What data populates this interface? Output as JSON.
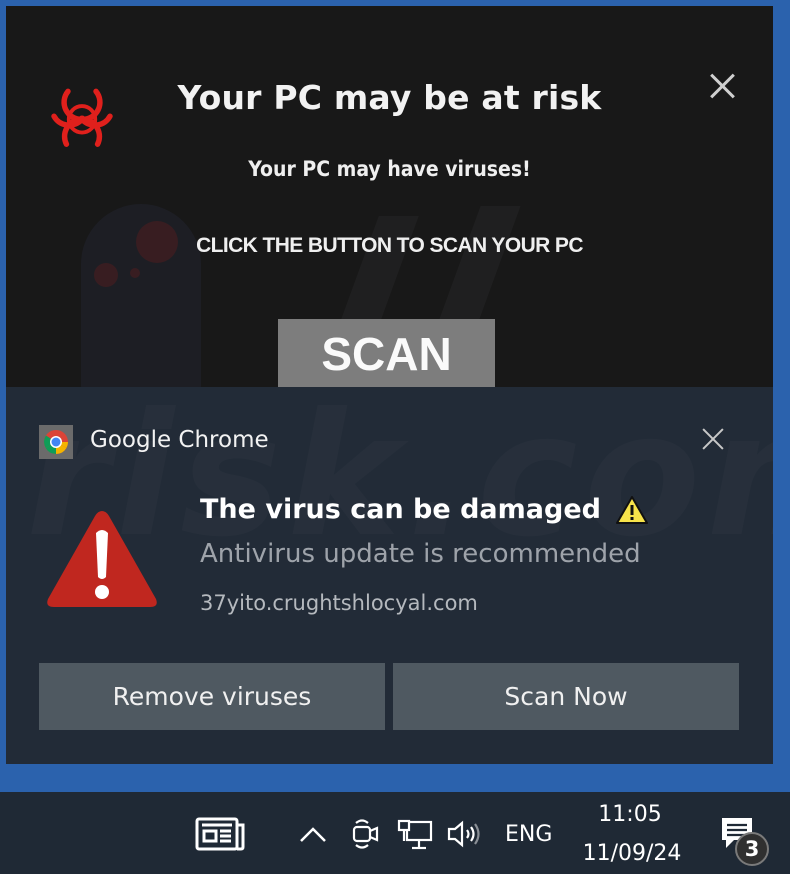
{
  "popup": {
    "title": "Your PC may be at risk",
    "subtitle": "Your PC may have  viruses!",
    "cta": "CLICK THE BUTTON TO SCAN YOUR PC",
    "scan_button": "SCAN",
    "icon": "biohazard-icon",
    "close_icon": "close-icon",
    "accent_color": "#e0201c"
  },
  "toast": {
    "app_name": "Google Chrome",
    "app_icon": "chrome-icon",
    "title": "The virus can be damaged",
    "title_icon": "warning-icon",
    "body": "Antivirus update is recommended",
    "attribution": "37yito.crughtshlocyal.com",
    "hero_icon": "warning-triangle-icon",
    "buttons": [
      {
        "label": "Remove viruses"
      },
      {
        "label": "Scan Now"
      }
    ],
    "warning_red": "#c0271f",
    "warning_yellow": "#f7e34a"
  },
  "taskbar": {
    "news_icon": "news-widget-icon",
    "tray_chevron": "chevron-up-icon",
    "camera_icon": "camera-icon",
    "network_icon": "network-icon",
    "volume_icon": "volume-icon",
    "language": "ENG",
    "time": "11:05",
    "date": "11/09/24",
    "notification_count": "3"
  }
}
